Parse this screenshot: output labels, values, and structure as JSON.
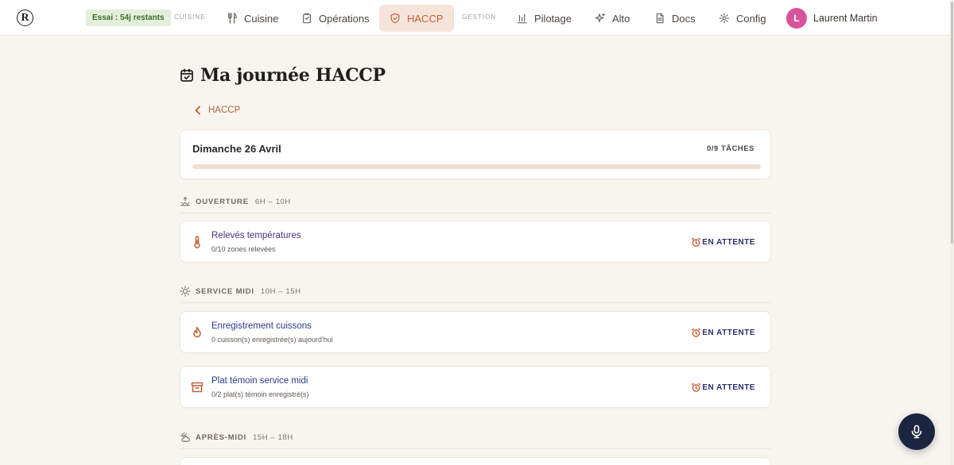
{
  "app": {
    "logo_letter": "R",
    "trial_badge": "Essai : 54j restants"
  },
  "nav": {
    "group_cuisine": "CUISINE",
    "group_gestion": "GESTION",
    "items": [
      {
        "label": "Cuisine",
        "icon": "utensils-icon"
      },
      {
        "label": "Opérations",
        "icon": "clipboard-icon"
      },
      {
        "label": "HACCP",
        "icon": "shield-icon",
        "active": true
      },
      {
        "label": "Pilotage",
        "icon": "bar-chart-icon"
      },
      {
        "label": "Alto",
        "icon": "sparkles-icon"
      },
      {
        "label": "Docs",
        "icon": "document-icon"
      },
      {
        "label": "Config",
        "icon": "gear-icon"
      }
    ],
    "user": {
      "initial": "L",
      "name": "Laurent Martin",
      "avatar_color": "#d6559a"
    }
  },
  "page": {
    "title": "Ma journée HACCP",
    "back_label": "HACCP",
    "summary": {
      "date": "Dimanche 26 Avril",
      "count": "0/9 TÂCHES",
      "progress_fraction": 0
    }
  },
  "sections": [
    {
      "name": "OUVERTURE",
      "time": "6H – 10H",
      "icon": "sunrise-icon"
    },
    {
      "name": "SERVICE MIDI",
      "time": "10H – 15H",
      "icon": "sun-icon"
    },
    {
      "name": "APRÈS-MIDI",
      "time": "15H – 18H",
      "icon": "cloud-sun-icon"
    }
  ],
  "tasks": [
    {
      "name": "Relevés températures",
      "sub": "0/10 zones relevées",
      "status": "EN ATTENTE",
      "icon": "thermometer-icon",
      "name_color": "#4a2f7a"
    },
    {
      "name": "Enregistrement cuissons",
      "sub": "0 cuisson(s) enregistrée(s) aujourd'hui",
      "status": "EN ATTENTE",
      "icon": "flame-icon",
      "name_color": "#2b3a8a"
    },
    {
      "name": "Plat témoin service midi",
      "sub": "0/2 plat(s) témoin enregistré(s)",
      "status": "EN ATTENTE",
      "icon": "archive-box-icon",
      "name_color": "#2b3a8a"
    }
  ],
  "colors": {
    "accent": "#c2613a",
    "status_text": "#2b2f6e",
    "fab": "#1c2540",
    "trial_bg": "#e3eedb"
  }
}
